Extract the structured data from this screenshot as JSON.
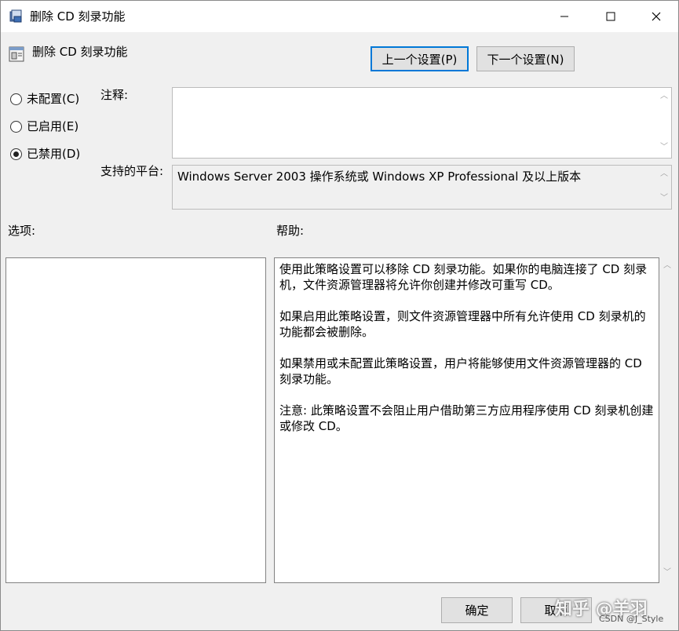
{
  "window": {
    "title": "删除 CD 刻录功能",
    "controls": {
      "minimize": "minimize-icon",
      "maximize": "maximize-icon",
      "close": "close-icon"
    }
  },
  "header": {
    "policy_title": "删除 CD 刻录功能",
    "prev_label": "上一个设置(P)",
    "next_label": "下一个设置(N)"
  },
  "state": {
    "options": [
      {
        "label": "未配置(C)",
        "checked": false
      },
      {
        "label": "已启用(E)",
        "checked": false
      },
      {
        "label": "已禁用(D)",
        "checked": true
      }
    ]
  },
  "comment": {
    "label": "注释:",
    "value": ""
  },
  "platform": {
    "label": "支持的平台:",
    "value": "Windows Server 2003 操作系统或 Windows XP Professional 及以上版本"
  },
  "options_panel": {
    "label": "选项:"
  },
  "help_panel": {
    "label": "帮助:",
    "paragraphs": [
      "使用此策略设置可以移除 CD 刻录功能。如果你的电脑连接了 CD 刻录机，文件资源管理器将允许你创建并修改可重写 CD。",
      "如果启用此策略设置，则文件资源管理器中所有允许使用 CD 刻录机的功能都会被删除。",
      "如果禁用或未配置此策略设置，用户将能够使用文件资源管理器的 CD 刻录功能。",
      "注意: 此策略设置不会阻止用户借助第三方应用程序使用 CD 刻录机创建或修改 CD。"
    ]
  },
  "footer": {
    "ok_label": "确定",
    "cancel_label": "取消"
  },
  "watermark": {
    "main": "知乎 @羊羽",
    "sub": "CSDN @J_Style"
  }
}
